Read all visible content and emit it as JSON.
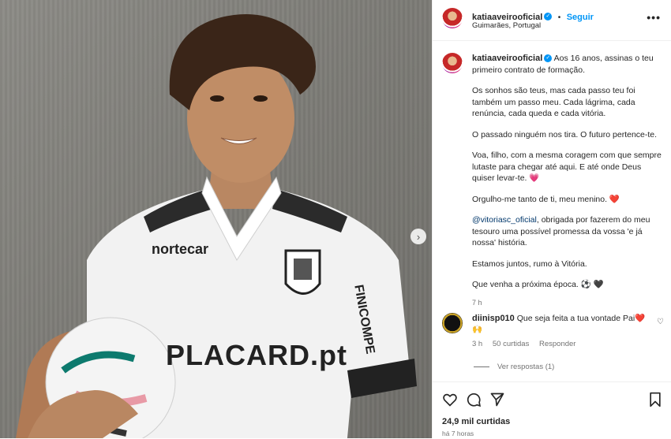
{
  "header": {
    "username": "katiaaveirooficial",
    "follow_label": "Seguir",
    "location": "Guimarães, Portugal",
    "more_icon": "more-horizontal-icon"
  },
  "photo": {
    "sponsor_chest": "nortecar",
    "sponsor_front": "PLACARD.pt",
    "sleeve_text": "FINICOMPE"
  },
  "caption": {
    "username": "katiaaveirooficial",
    "p1": "Aos 16 anos, assinas o teu primeiro contrato de formação.",
    "p2": "Os sonhos são teus, mas cada passo teu foi também um passo meu. Cada lágrima, cada renúncia, cada queda e cada vitória.",
    "p3": "O passado ninguém nos tira. O futuro pertence-te.",
    "p4": "Voa, filho, com a mesma coragem com que sempre lutaste para chegar até aqui. E até onde Deus quiser levar-te. 💗",
    "p5": "Orgulho-me tanto de ti, meu menino. ❤️",
    "mention": "@vitoriasc_oficial",
    "p6": ", obrigada por fazerem do meu tesouro uma possível promessa da vossa 'e já nossa' história.",
    "p7": "Estamos juntos, rumo à Vitória.",
    "p8": "Que venha a próxima época. ⚽ 🖤",
    "time": "7 h"
  },
  "comment": {
    "username": "diinisp010",
    "text": "Que seja feita a tua vontade Pai❤️🙌",
    "time": "3 h",
    "likes": "50 curtidas",
    "reply_label": "Responder",
    "view_replies": "Ver respostas (1)"
  },
  "footer": {
    "likes": "24,9 mil curtidas",
    "ago": "há 7 horas"
  }
}
